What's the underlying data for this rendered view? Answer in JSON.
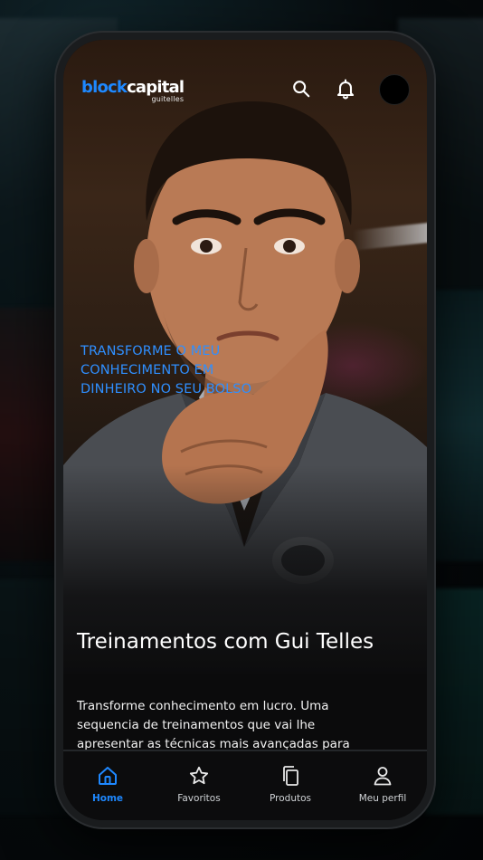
{
  "app": {
    "logo_main_a": "block",
    "logo_main_b": "capital",
    "logo_sub": "guitelles"
  },
  "header": {
    "search_icon": "search-icon",
    "notification_icon": "bell-icon"
  },
  "hero": {
    "tagline": "TRANSFORME O MEU CONHECIMENTO EM DINHEIRO NO SEU BOLSO"
  },
  "content": {
    "title": "Treinamentos com Gui Telles",
    "description": "Transforme conhecimento em lucro. Uma sequencia de treinamentos que vai lhe apresentar as técnicas mais avançadas para"
  },
  "tabbar": {
    "items": [
      {
        "label": "Home",
        "icon": "home-icon",
        "active": true
      },
      {
        "label": "Favoritos",
        "icon": "star-icon",
        "active": false
      },
      {
        "label": "Produtos",
        "icon": "copy-icon",
        "active": false
      },
      {
        "label": "Meu perfil",
        "icon": "user-icon",
        "active": false
      }
    ]
  },
  "colors": {
    "accent": "#1E88FF",
    "background": "#0B0B0C",
    "text": "#FFFFFF"
  }
}
